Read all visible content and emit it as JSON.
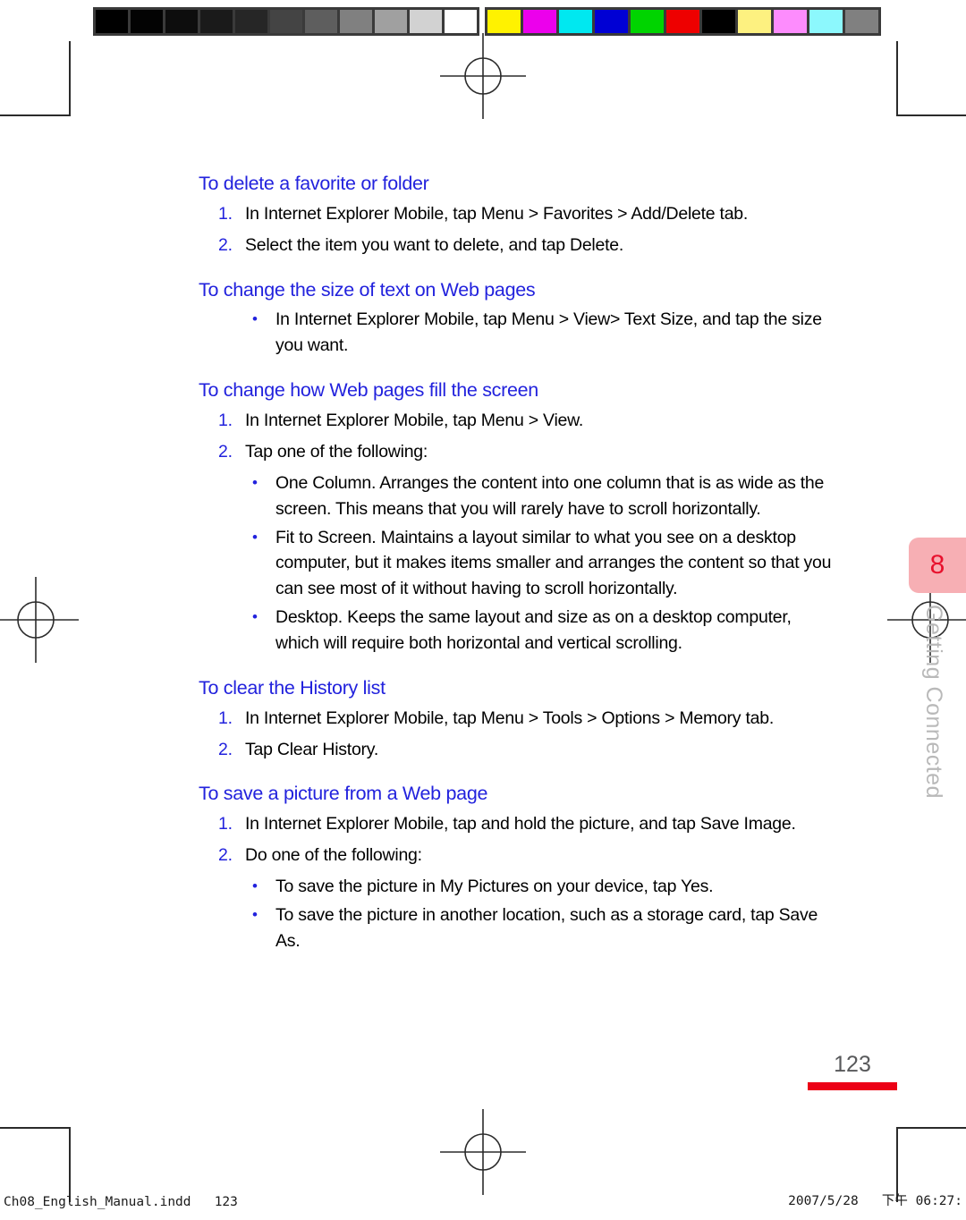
{
  "calibration": {
    "grayscale_swatches": [
      "#000000",
      "#030303",
      "#0d0d0d",
      "#1a1a1a",
      "#262626",
      "#444444",
      "#5e5e5e",
      "#808080",
      "#a0a0a0",
      "#d2d2d2",
      "#ffffff"
    ],
    "color_swatches": [
      "#fff200",
      "#ec00ec",
      "#00e8f0",
      "#0000d4",
      "#00d400",
      "#ee0000",
      "#000000",
      "#fdf180",
      "#fd8cfd",
      "#8cf8fd",
      "#808080"
    ]
  },
  "colors": {
    "heading_blue": "#2222dd",
    "marker_blue": "#2222dd",
    "tab_pink": "#f7afb4",
    "tab_number_red": "#e8112d",
    "page_rule_red": "#ec0016",
    "page_number_gray": "#58595b",
    "chapter_title_gray": "#b9b9b9"
  },
  "sections": [
    {
      "heading": "To delete a favorite or folder",
      "items": [
        {
          "marker": "1.",
          "text": "In Internet Explorer Mobile, tap Menu > Favorites > Add/Delete tab."
        },
        {
          "marker": "2.",
          "text": "Select the item you want to delete, and tap Delete."
        }
      ]
    },
    {
      "heading": "To change the size of text on Web pages",
      "items": [
        {
          "marker": "•",
          "text": "In Internet Explorer Mobile, tap Menu > View> Text Size, and tap the size you want."
        }
      ]
    },
    {
      "heading": "To change how Web pages fill the screen",
      "items": [
        {
          "marker": "1.",
          "text": "In Internet Explorer Mobile, tap Menu > View."
        },
        {
          "marker": "2.",
          "text": "Tap one of the following:"
        }
      ],
      "subitems": [
        {
          "marker": "•",
          "text": "One Column. Arranges the content into one column that is as wide as the screen. This means that you will rarely have to scroll horizontally."
        },
        {
          "marker": "•",
          "text": "Fit to Screen. Maintains a layout similar to what you see on a desktop computer, but it makes items smaller and arranges the content so that you can see most of it without having to scroll horizontally."
        },
        {
          "marker": "•",
          "text": "Desktop. Keeps the same layout and size as on a desktop computer, which will require both horizontal and vertical scrolling."
        }
      ]
    },
    {
      "heading": "To clear the History list",
      "items": [
        {
          "marker": "1.",
          "text": "In Internet Explorer Mobile, tap Menu > Tools > Options > Memory tab."
        },
        {
          "marker": "2.",
          "text": "Tap Clear History."
        }
      ]
    },
    {
      "heading": "To save a picture from a Web page",
      "items": [
        {
          "marker": "1.",
          "text": "In Internet Explorer Mobile, tap and hold the picture, and tap Save Image."
        },
        {
          "marker": "2.",
          "text": "Do one of the following:"
        }
      ],
      "subitems": [
        {
          "marker": "•",
          "text": "To save the picture in My Pictures on your device, tap Yes."
        },
        {
          "marker": "•",
          "text": "To save the picture in another location, such as a storage card, tap Save As."
        }
      ]
    }
  ],
  "chapter": {
    "number": "8",
    "title": "Getting Connected"
  },
  "page_number": "123",
  "footer": {
    "left": "Ch08_English_Manual.indd   123",
    "right": "2007/5/28   下午 06:27:"
  }
}
